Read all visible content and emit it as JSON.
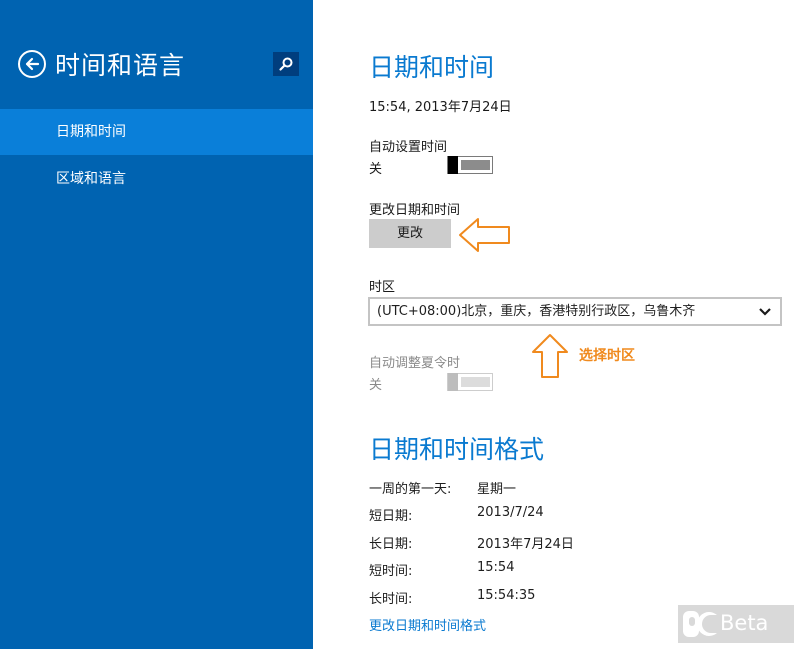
{
  "sidebar": {
    "title": "时间和语言",
    "items": [
      {
        "label": "日期和时间",
        "selected": true
      },
      {
        "label": "区域和语言",
        "selected": false
      }
    ],
    "icons": {
      "back": "back-arrow-icon",
      "search": "search-icon"
    }
  },
  "datetime": {
    "heading": "日期和时间",
    "current": "15:54, 2013年7月24日",
    "auto_time": {
      "label": "自动设置时间",
      "state": "关"
    },
    "change": {
      "label": "更改日期和时间",
      "button": "更改"
    },
    "timezone": {
      "label": "时区",
      "value": "(UTC+08:00)北京，重庆，香港特别行政区，乌鲁木齐"
    },
    "dst": {
      "label": "自动调整夏令时",
      "state": "关"
    }
  },
  "formats": {
    "heading": "日期和时间格式",
    "rows": [
      {
        "label": "一周的第一天:",
        "value": "星期一"
      },
      {
        "label": "短日期:",
        "value": "2013/7/24"
      },
      {
        "label": "长日期:",
        "value": "2013年7月24日"
      },
      {
        "label": "短时间:",
        "value": "15:54"
      },
      {
        "label": "长时间:",
        "value": "15:54:35"
      }
    ],
    "link": "更改日期和时间格式"
  },
  "annotation": {
    "text": "选择时区",
    "color": "#f08a1e"
  },
  "watermark": {
    "text": "Beta",
    "logo_letters": "pc"
  },
  "colors": {
    "sidebar": "#0063b1",
    "selected": "#0a7fd9",
    "accent": "#0a7ad0"
  }
}
